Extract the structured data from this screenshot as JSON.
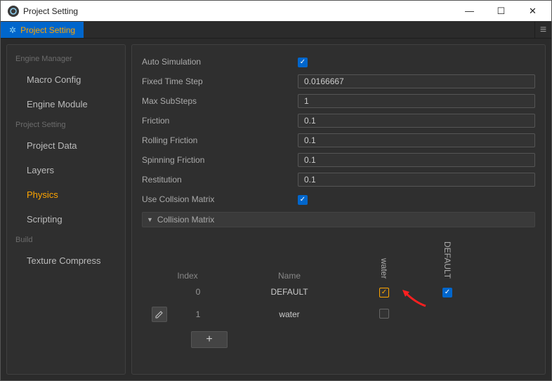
{
  "window": {
    "title": "Project Setting"
  },
  "tab": {
    "label": "Project Setting"
  },
  "sidebar": {
    "groups": [
      {
        "label": "Engine Manager",
        "items": [
          "Macro Config",
          "Engine Module"
        ]
      },
      {
        "label": "Project Setting",
        "items": [
          "Project Data",
          "Layers",
          "Physics",
          "Scripting"
        ]
      },
      {
        "label": "Build",
        "items": [
          "Texture Compress"
        ]
      }
    ],
    "active": "Physics"
  },
  "props": {
    "auto_simulation": {
      "label": "Auto Simulation",
      "checked": true
    },
    "fixed_time_step": {
      "label": "Fixed Time Step",
      "value": "0.0166667"
    },
    "max_substeps": {
      "label": "Max SubSteps",
      "value": "1"
    },
    "friction": {
      "label": "Friction",
      "value": "0.1"
    },
    "rolling_friction": {
      "label": "Rolling Friction",
      "value": "0.1"
    },
    "spinning_friction": {
      "label": "Spinning Friction",
      "value": "0.1"
    },
    "restitution": {
      "label": "Restitution",
      "value": "0.1"
    },
    "use_collision_matrix": {
      "label": "Use Collsion Matrix",
      "checked": true
    }
  },
  "collision_matrix": {
    "header": "Collision Matrix",
    "columns": {
      "index": "Index",
      "name": "Name"
    },
    "layers": [
      "water",
      "DEFAULT"
    ],
    "rows": [
      {
        "index": "0",
        "name": "DEFAULT",
        "checks": [
          true,
          true
        ]
      },
      {
        "index": "1",
        "name": "water",
        "checks": [
          false
        ]
      }
    ],
    "add_label": "+"
  }
}
